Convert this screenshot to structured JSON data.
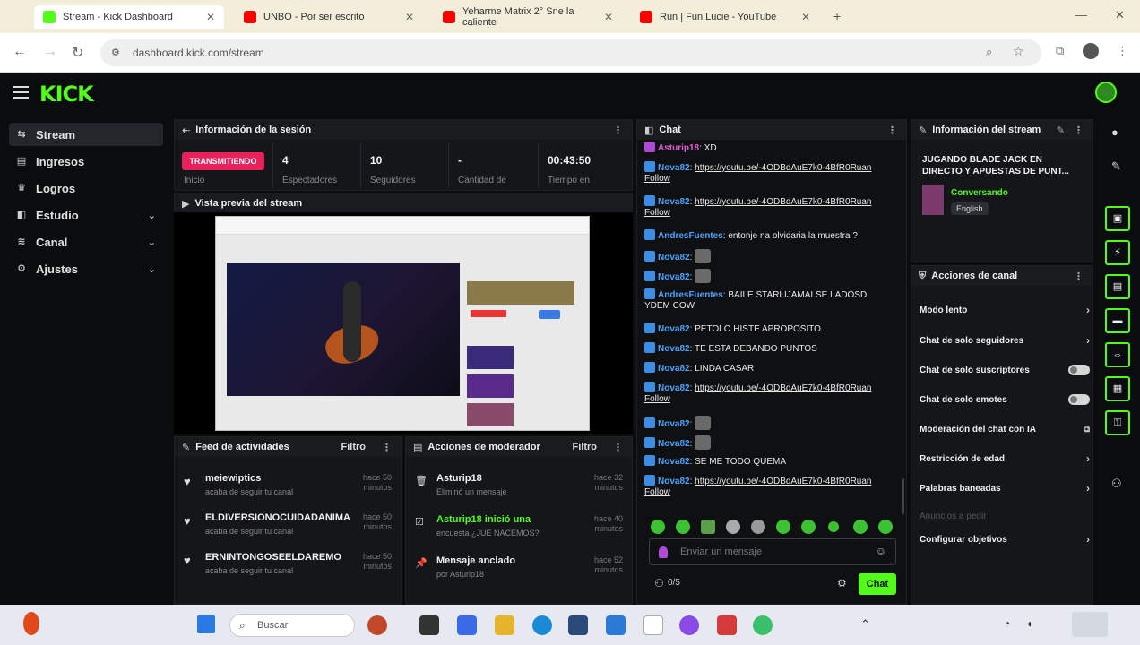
{
  "browser": {
    "tabs": [
      {
        "title": "Stream - Kick Dashboard",
        "color": "#53fc18",
        "active": true
      },
      {
        "title": "UNBO - Por ser escrito",
        "color": "#ff0000",
        "active": false
      },
      {
        "title": "Yeharme Matrix 2° Sne la caliente",
        "color": "#ff0000",
        "active": false
      },
      {
        "title": "Run | Fun Lucie - YouTube",
        "color": "#ff0000",
        "active": false
      }
    ],
    "url": "dashboard.kick.com/stream"
  },
  "kick": {
    "logo": "KICK"
  },
  "sidebar": {
    "items": [
      {
        "label": "Stream",
        "icon": "stream-icon",
        "glyph": "⇆",
        "chevron": false
      },
      {
        "label": "Ingresos",
        "icon": "income-icon",
        "glyph": "▤",
        "chevron": false
      },
      {
        "label": "Logros",
        "icon": "trophy-icon",
        "glyph": "♛",
        "chevron": false
      },
      {
        "label": "Estudio",
        "icon": "studio-icon",
        "glyph": "◧",
        "chevron": true
      },
      {
        "label": "Canal",
        "icon": "channel-icon",
        "glyph": "≋",
        "chevron": true
      },
      {
        "label": "Ajustes",
        "icon": "gear-icon",
        "glyph": "⚙",
        "chevron": true
      }
    ]
  },
  "session": {
    "title": "Información de la sesión",
    "live_label": "TRANSMITIENDO",
    "live_caption": "Inicio",
    "stats": [
      {
        "value": "4",
        "label": "Espectadores"
      },
      {
        "value": "10",
        "label": "Seguidores"
      },
      {
        "value": "-",
        "label": "Cantidad de"
      },
      {
        "value": "00:43:50",
        "label": "Tiempo en"
      }
    ]
  },
  "preview": {
    "title": "Vista previa del stream"
  },
  "activity": {
    "title": "Feed de actividades",
    "filter": "Filtro",
    "rows": [
      {
        "name": "meiewiptics",
        "desc": "acaba de seguir tu canal",
        "time": "hace 50 minutos"
      },
      {
        "name": "ELDIVERSIONOCUIDADANIMA",
        "desc": "acaba de seguir tu canal",
        "time": "hace 50 minutos"
      },
      {
        "name": "ERNINTONGOSEELDAREMO",
        "desc": "acaba de seguir tu canal",
        "time": "hace 50 minutos"
      }
    ]
  },
  "modactions": {
    "title": "Acciones de moderador",
    "filter": "Filtro",
    "rows": [
      {
        "icon": "trash-icon",
        "glyph": "🗑",
        "name": "Asturip18",
        "desc": "Eliminó un mensaje",
        "time": "hace 32 minutos",
        "green": false
      },
      {
        "icon": "check-icon",
        "glyph": "☑",
        "name": "Asturip18 inició una",
        "desc": "encuesta ¿JUE NACEMOS?",
        "time": "hace 40 minutos",
        "green": true
      },
      {
        "icon": "pin-icon",
        "glyph": "📌",
        "name": "Mensaje anclado",
        "desc": "por Asturip18",
        "time": "hace 52 minutos",
        "green": false
      }
    ]
  },
  "chat": {
    "title": "Chat",
    "placeholder": "Enviar un mensaje",
    "send": "Chat",
    "count": "0/5",
    "messages": [
      {
        "user": "Asturip18",
        "pink": true,
        "text": "XD",
        "emote": false,
        "link": false
      },
      {
        "user": "Nova82",
        "pink": false,
        "text": "https://youtu.be/-4ODBdAuE7k0-4BfR0Ruan Follow",
        "emote": false,
        "link": true
      },
      {
        "user": "Nova82",
        "pink": false,
        "text": "https://youtu.be/-4ODBdAuE7k0-4BfR0Ruan Follow",
        "emote": false,
        "link": true
      },
      {
        "user": "AndresFuentes",
        "pink": false,
        "text": "entonje na olvidaria la muestra ?",
        "emote": false,
        "link": false
      },
      {
        "user": "Nova82",
        "pink": false,
        "text": "",
        "emote": true,
        "link": false
      },
      {
        "user": "Nova82",
        "pink": false,
        "text": "",
        "emote": true,
        "link": false
      },
      {
        "user": "AndresFuentes",
        "pink": false,
        "text": "BAILE STARLIJAMAI SE LADOSD YDEM COW",
        "emote": false,
        "link": false
      },
      {
        "user": "Nova82",
        "pink": false,
        "text": "PETOLO HISTE APROPOSITO",
        "emote": false,
        "link": false
      },
      {
        "user": "Nova82",
        "pink": false,
        "text": "TE ESTA DEBANDO PUNTOS",
        "emote": false,
        "link": false
      },
      {
        "user": "Nova82",
        "pink": false,
        "text": "LINDA CASAR",
        "emote": false,
        "link": false
      },
      {
        "user": "Nova82",
        "pink": false,
        "text": "https://youtu.be/-4ODBdAuE7k0-4BfR0Ruan Follow",
        "emote": false,
        "link": true
      },
      {
        "user": "Nova82",
        "pink": false,
        "text": "",
        "emote": true,
        "link": false
      },
      {
        "user": "Nova82",
        "pink": false,
        "text": "",
        "emote": true,
        "link": false
      },
      {
        "user": "Nova82",
        "pink": false,
        "text": "SE ME TODO QUEMA",
        "emote": false,
        "link": false
      },
      {
        "user": "Nova82",
        "pink": false,
        "text": "https://youtu.be/-4ODBdAuE7k0-4BfR0Ruan Follow",
        "emote": false,
        "link": true
      }
    ]
  },
  "streaminfo": {
    "title": "Información del stream",
    "stream_title": "JUGANDO BLADE JACK EN DIRECTO Y APUESTAS DE PUNT...",
    "category": "Conversando",
    "language": "English"
  },
  "channelactions": {
    "title": "Acciones de canal",
    "items": [
      {
        "label": "Modo lento",
        "control": "chevron"
      },
      {
        "label": "Chat de solo seguidores",
        "control": "chevron"
      },
      {
        "label": "Chat de solo suscriptores",
        "control": "toggle"
      },
      {
        "label": "Chat de solo emotes",
        "control": "toggle"
      },
      {
        "label": "Moderación del chat con IA",
        "control": "external"
      },
      {
        "label": "Restricción de edad",
        "control": "chevron"
      },
      {
        "label": "Palabras baneadas",
        "control": "chevron"
      },
      {
        "label": "Anuncios a pedir",
        "control": "none"
      },
      {
        "label": "Configurar objetivos",
        "control": "chevron"
      }
    ]
  },
  "taskbar": {
    "search_placeholder": "Buscar"
  },
  "colors": {
    "accent": "#53fc18",
    "live": "#e8215a",
    "chatuser": "#4aa3ff"
  }
}
